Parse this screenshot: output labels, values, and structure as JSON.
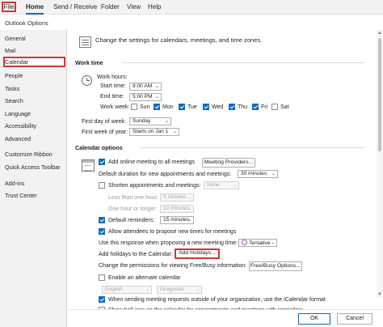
{
  "ribbon": {
    "tabs": [
      "File",
      "Home",
      "Send / Receive",
      "Folder",
      "View",
      "Help"
    ]
  },
  "dialog": {
    "title": "Outlook Options"
  },
  "nav": {
    "items": [
      "General",
      "Mail",
      "Calendar",
      "People",
      "Tasks",
      "Search",
      "Language",
      "Accessibility",
      "Advanced",
      "Customize Ribbon",
      "Quick Access Toolbar",
      "Add-ins",
      "Trust Center"
    ],
    "selected": "Calendar"
  },
  "header": {
    "text": "Change the settings for calendars, meetings, and time zones."
  },
  "work_time": {
    "title": "Work time",
    "hours_label": "Work hours:",
    "start_label": "Start time:",
    "start_value": "8:00 AM",
    "end_label": "End time:",
    "end_value": "5:00 PM",
    "week_label": "Work week:",
    "days": [
      {
        "label": "Sun",
        "checked": false
      },
      {
        "label": "Mon",
        "checked": true
      },
      {
        "label": "Tue",
        "checked": true
      },
      {
        "label": "Wed",
        "checked": true
      },
      {
        "label": "Thu",
        "checked": true
      },
      {
        "label": "Fri",
        "checked": true
      },
      {
        "label": "Sat",
        "checked": false
      }
    ],
    "first_day_label": "First day of week:",
    "first_day_value": "Sunday",
    "first_week_label": "First week of year:",
    "first_week_value": "Starts on Jan 1"
  },
  "calendar_options": {
    "title": "Calendar options",
    "online_meetings": "Add online meeting to all meetings",
    "meeting_providers_btn": "Meeting Providers...",
    "default_duration_label": "Default duration for new appointments and meetings:",
    "default_duration_value": "30 minutes",
    "shorten_label": "Shorten appointments and meetings:",
    "shorten_value": "None",
    "less_than_hour_label": "Less than one hour:",
    "less_than_hour_value": "5 minutes",
    "one_hour_label": "One hour or longer:",
    "one_hour_value": "10 minutes",
    "default_reminders_label": "Default reminders:",
    "default_reminders_value": "15 minutes",
    "allow_attendees": "Allow attendees to propose new times for meetings",
    "use_response_label": "Use this response when proposing a new meeting time:",
    "use_response_value": "Tentative",
    "add_holidays_label": "Add holidays to the Calendar:",
    "add_holidays_btn": "Add Holidays...",
    "free_busy_label": "Change the permissions for viewing Free/Busy information:",
    "free_busy_btn": "Free/Busy Options...",
    "alternate_calendar": "Enable an alternate calendar",
    "alt_language": "English",
    "alt_calendar": "Gregorian",
    "icalendar": "When sending meeting requests outside of your organization, use the iCalendar format",
    "bell_icon": "Show bell icon on the calendar for appointments and meetings with reminders"
  },
  "footer": {
    "ok": "OK",
    "cancel": "Cancel"
  },
  "colors": {
    "accent": "#0f6cbd",
    "highlight": "#d13438"
  }
}
